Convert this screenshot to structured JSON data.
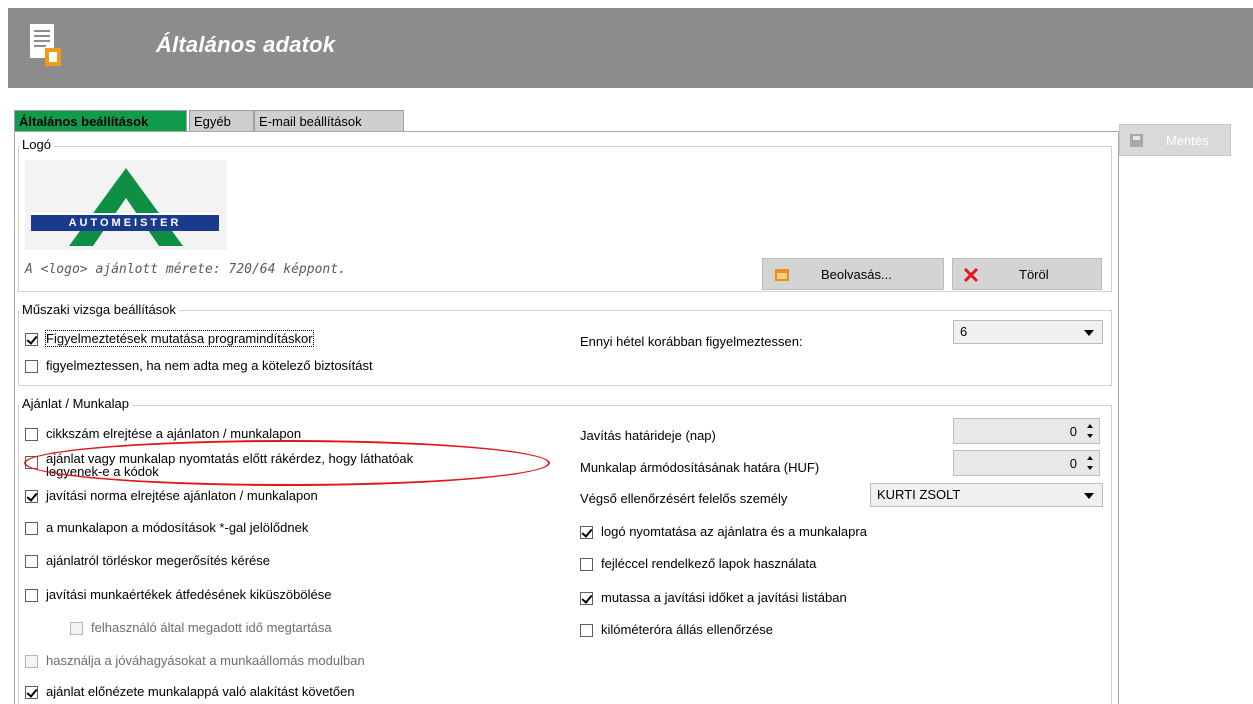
{
  "header": {
    "title": "Általános adatok",
    "icon": "document-form-icon"
  },
  "save_button": {
    "label": "Mentés",
    "icon": "save-icon"
  },
  "tabs": [
    {
      "label": "Általános beállítások",
      "active": true
    },
    {
      "label": "Egyéb",
      "active": false
    },
    {
      "label": "E-mail beállítások",
      "active": false
    }
  ],
  "logo_section": {
    "legend": "Logó",
    "logo_text": "AUTOMEISTER",
    "hint": "A <logo> ajánlott mérete:  720/64 képpont.",
    "load_button": "Beolvasás...",
    "delete_button": "Töröl"
  },
  "inspection_section": {
    "legend": "Műszaki vizsga beállítások",
    "checkboxes": [
      {
        "label": "Figyelmeztetések mutatása programindításkor",
        "checked": true
      },
      {
        "label": "figyelmeztessen, ha nem adta meg a kötelező biztosítást",
        "checked": false
      }
    ],
    "weeks_label": "Ennyi hétel korábban figyelmeztessen:",
    "weeks_value": "6"
  },
  "offer_section": {
    "legend": "Ajánlat / Munkalap",
    "checkboxes": [
      {
        "label": "cikkszám elrejtése a ajánlaton / munkalapon",
        "checked": false
      },
      {
        "label": "ajánlat vagy munkalap nyomtatás előtt rákérdez, hogy láthatóak",
        "label2": "legyenek-e a kódok",
        "checked": false
      },
      {
        "label": "javítási norma elrejtése ajánlaton / munkalapon",
        "checked": true
      },
      {
        "label": "a munkalapon a módosítások *-gal jelölődnek",
        "checked": false
      },
      {
        "label": "ajánlatról törléskor megerősítés kérése",
        "checked": false
      },
      {
        "label": "javítási munkaértékek átfedésének kiküszöbölése",
        "checked": false
      },
      {
        "label": "felhasználó által megadott idő megtartása",
        "checked": false,
        "disabled": true
      },
      {
        "label": "használja a jóváhagyásokat a munkaállomás modulban",
        "checked": false,
        "disabled": true
      },
      {
        "label": "ajánlat előnézete munkalappá való alakítást követően",
        "checked": true
      }
    ],
    "deadline_label": "Javítás határideje (nap)",
    "deadline_value": "0",
    "price_limit_label": "Munkalap ármódosításának határa (HUF)",
    "price_limit_value": "0",
    "responsible_label": "Végső ellenőrzésért felelős személy",
    "responsible_value": "KURTI ZSOLT",
    "right_checkboxes": [
      {
        "label": "logó nyomtatása az ajánlatra és a munkalapra",
        "checked": true
      },
      {
        "label": "fejléccel rendelkező lapok használata",
        "checked": false
      },
      {
        "label": "mutassa a javítási időket a javítási listában",
        "checked": true
      },
      {
        "label": "kilóméteróra állás ellenőrzése",
        "checked": false
      }
    ]
  },
  "colors": {
    "header_bg": "#8c8c8c",
    "active_tab": "#109c4c",
    "highlight": "#e0161b"
  }
}
